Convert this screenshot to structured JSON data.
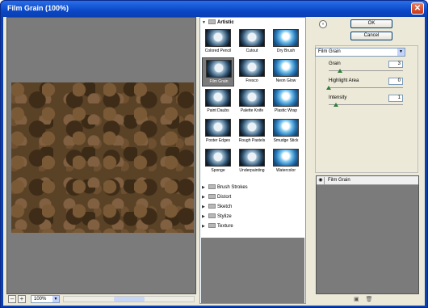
{
  "window": {
    "title": "Film Grain (100%)"
  },
  "preview": {
    "zoom_minus": "–",
    "zoom_plus": "+",
    "zoom_value": "100%"
  },
  "gallery": {
    "categories_open": "Artistic",
    "filters": [
      {
        "label": "Colored Pencil"
      },
      {
        "label": "Cutout"
      },
      {
        "label": "Dry Brush"
      },
      {
        "label": "Film Grain",
        "selected": true
      },
      {
        "label": "Fresco"
      },
      {
        "label": "Neon Glow"
      },
      {
        "label": "Paint Daubs"
      },
      {
        "label": "Palette Knife"
      },
      {
        "label": "Plastic Wrap"
      },
      {
        "label": "Poster Edges"
      },
      {
        "label": "Rough Pastels"
      },
      {
        "label": "Smudge Stick"
      },
      {
        "label": "Sponge"
      },
      {
        "label": "Underpainting"
      },
      {
        "label": "Watercolor"
      }
    ],
    "categories_closed": [
      "Brush Strokes",
      "Distort",
      "Sketch",
      "Stylize",
      "Texture"
    ]
  },
  "buttons": {
    "ok": "OK",
    "cancel": "Cancel"
  },
  "settings": {
    "filter_select": "Film Grain",
    "params": [
      {
        "label": "Grain",
        "value": "3",
        "fraction": 0.15
      },
      {
        "label": "Highlight Area",
        "value": "0",
        "fraction": 0.0
      },
      {
        "label": "Intensity",
        "value": "1",
        "fraction": 0.1
      }
    ]
  },
  "layers": {
    "items": [
      "Film Grain"
    ]
  }
}
